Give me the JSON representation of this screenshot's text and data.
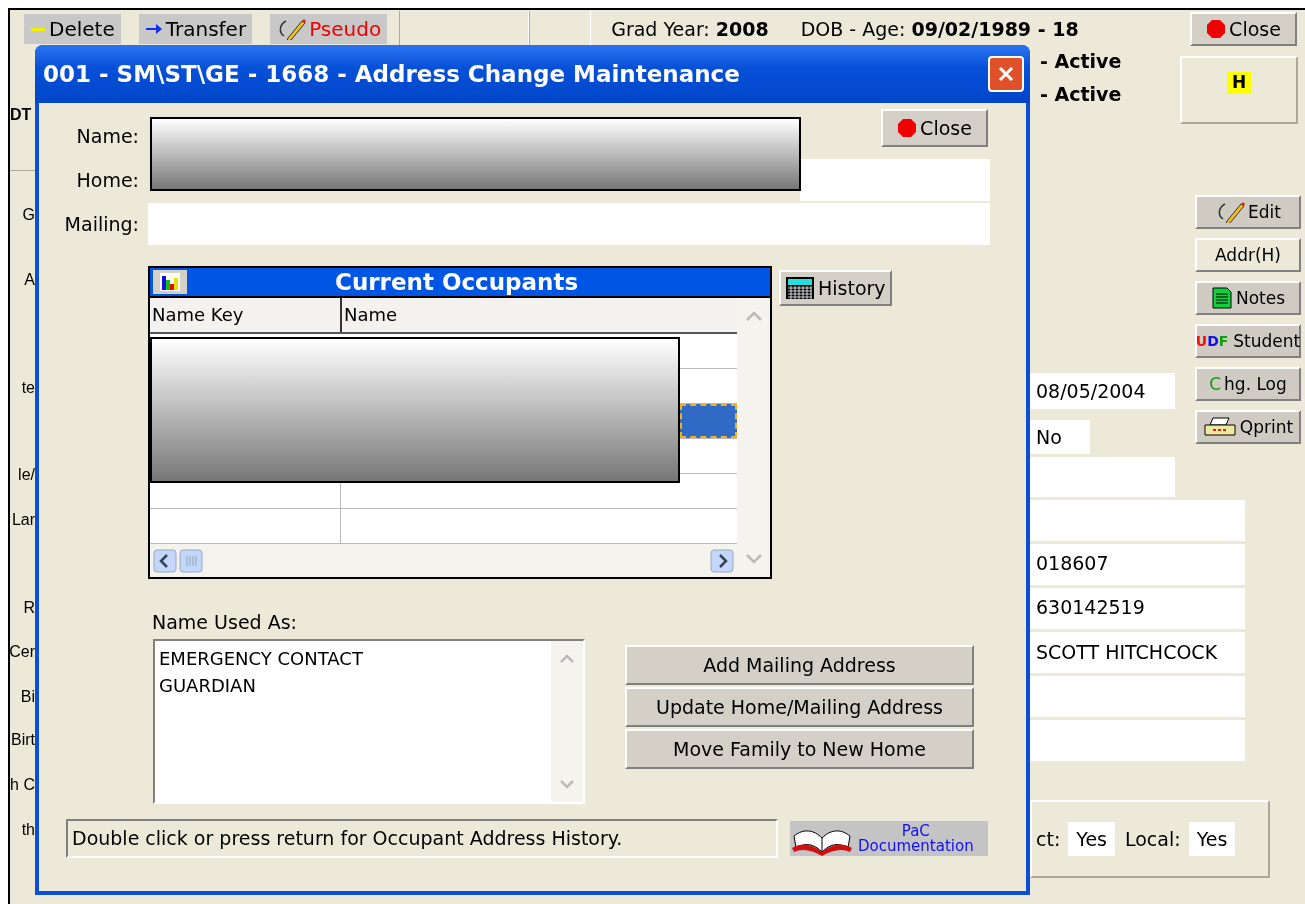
{
  "app": {
    "toolbar": [
      {
        "label": "Delete",
        "kind": "delete"
      },
      {
        "label": "Transfer",
        "kind": "transfer"
      },
      {
        "label": "Pseudo",
        "kind": "pseudo"
      }
    ],
    "grad_year": {
      "label": "Grad Year:",
      "value": "2008"
    },
    "dob_age": {
      "label": "DOB - Age:",
      "value": "09/02/1989 - 18"
    },
    "close_button": "Close",
    "statuses": [
      "- Active",
      "- Active"
    ],
    "flag": "H",
    "left_labels": [
      "DT",
      "G",
      "A",
      "te",
      "le/",
      "Lar",
      "R",
      "Cer",
      "Bi",
      "Birt",
      "h C",
      "th"
    ],
    "side_buttons": [
      {
        "label": "Edit",
        "kind": "edit"
      },
      {
        "label": "Addr(H)",
        "kind": "plain"
      },
      {
        "label": "Notes",
        "kind": "notes"
      },
      {
        "label": "Student",
        "kind": "udf",
        "tag": "UDF"
      },
      {
        "label": "Chg. Log",
        "kind": "log"
      },
      {
        "label": "Qprint",
        "kind": "print"
      }
    ],
    "fields": [
      {
        "kind": "text",
        "value": "08/05/2004"
      },
      {
        "kind": "text",
        "value": "No"
      },
      {
        "kind": "blank"
      },
      {
        "kind": "blank"
      },
      {
        "kind": "text",
        "value": "018607"
      },
      {
        "kind": "text",
        "value": "630142519"
      },
      {
        "kind": "text",
        "value": "SCOTT HITCHCOCK"
      },
      {
        "kind": "blank"
      },
      {
        "kind": "blank"
      }
    ],
    "flag_fields": [
      {
        "label": "ct:",
        "value": "Yes"
      },
      {
        "label": "Local:",
        "value": "Yes"
      }
    ]
  },
  "dialog": {
    "title": "001 - SM\\ST\\GE - 1668 - Address Change Maintenance",
    "close_button": "Close",
    "fields": [
      {
        "label": "Name:"
      },
      {
        "label": "Home:"
      },
      {
        "label": "Mailing:"
      }
    ],
    "occupants": {
      "title": "Current Occupants",
      "columns": [
        "Name Key",
        "Name"
      ],
      "rows": [
        {
          "selected": false
        },
        {
          "selected": false
        },
        {
          "selected": true
        },
        {
          "selected": false
        },
        {
          "selected": false
        },
        {
          "selected": false
        }
      ]
    },
    "history_button": "History",
    "used_as_label": "Name Used As:",
    "used_as": [
      "EMERGENCY CONTACT",
      "GUARDIAN"
    ],
    "actions": [
      "Add Mailing Address",
      "Update Home/Mailing Address",
      "Move Family to New Home"
    ],
    "status": "Double click or press return for Occupant Address History.",
    "doc_logo": {
      "line1": "PaC",
      "line2": "Documentation"
    }
  }
}
